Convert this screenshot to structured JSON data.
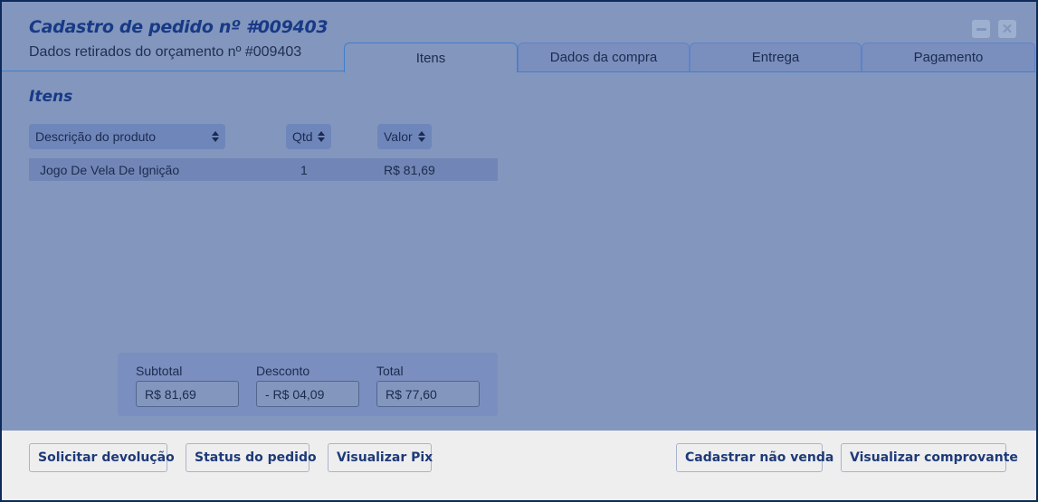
{
  "header": {
    "title": "Cadastro de pedido nº #009403",
    "subtitle": "Dados retirados do orçamento nº #009403"
  },
  "tabs": [
    {
      "label": "Itens",
      "active": true
    },
    {
      "label": "Dados da compra",
      "active": false
    },
    {
      "label": "Entrega",
      "active": false
    },
    {
      "label": "Pagamento",
      "active": false
    }
  ],
  "items_section": {
    "title": "Itens",
    "columns": [
      "Descrição  do produto",
      "Qtd",
      "Valor"
    ],
    "rows": [
      {
        "descricao": "Jogo De Vela De Ignição",
        "qtd": "1",
        "valor": "R$ 81,69"
      }
    ]
  },
  "totals": {
    "subtotal_label": "Subtotal",
    "subtotal_value": "R$ 81,69",
    "desconto_label": "Desconto",
    "desconto_value": "- R$ 04,09",
    "total_label": "Total",
    "total_value": "R$ 77,60"
  },
  "footer": {
    "solicitar_devolucao": "Solicitar devolução",
    "status_pedido": "Status do pedido",
    "visualizar_pix": "Visualizar Pix",
    "cadastrar_nao_venda": "Cadastrar não venda",
    "visualizar_comprovante": "Visualizar comprovante"
  },
  "colors": {
    "background": "#8396bd",
    "accent": "#173a86",
    "footer": "#eeeeee"
  }
}
